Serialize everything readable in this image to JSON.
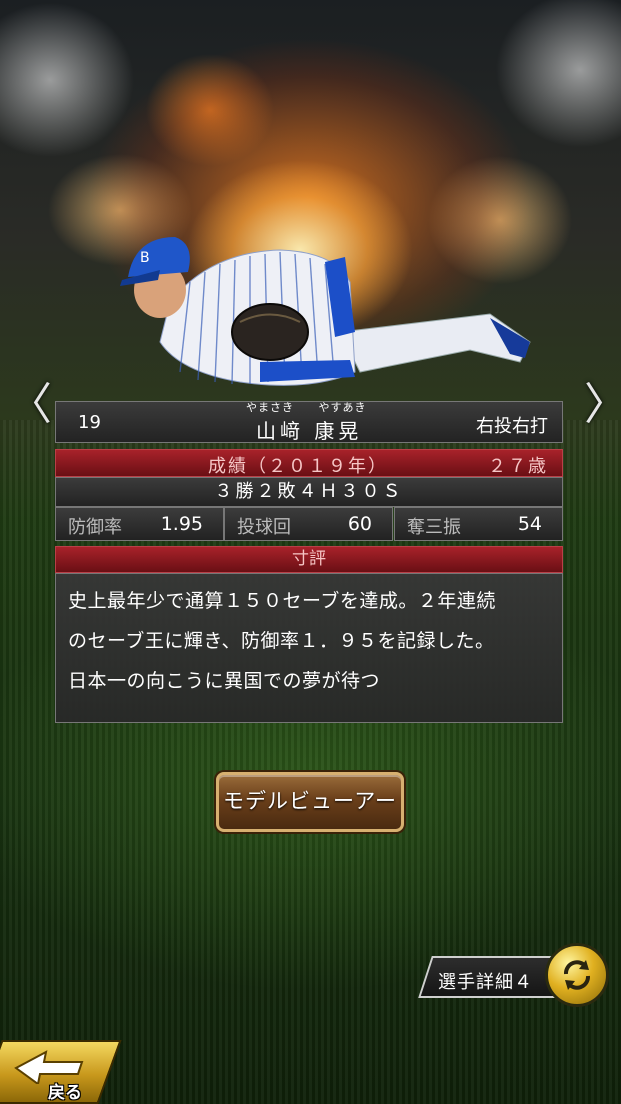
{
  "navigation": {
    "prev_icon": "chevron-left-icon",
    "next_icon": "chevron-right-icon",
    "prev_glyph": "〈",
    "next_glyph": "〉"
  },
  "player": {
    "number": "19",
    "ruby": [
      "やまさき",
      "やすあき"
    ],
    "name": "山﨑 康晃",
    "throws_bats": "右投右打"
  },
  "record": {
    "title": "成績（２０１９年）",
    "age": "２７歳",
    "summary": "３勝２敗４Ｈ３０Ｓ",
    "stats": [
      {
        "label": "防御率",
        "value": "1.95"
      },
      {
        "label": "投球回",
        "value": "60"
      },
      {
        "label": "奪三振",
        "value": "54"
      }
    ]
  },
  "review": {
    "title": "寸評",
    "lines": [
      "史上最年少で通算１５０セーブを達成。２年連続",
      "のセーブ王に輝き、防御率１．９５を記録した。",
      "日本一の向こうに異国での夢が待つ"
    ]
  },
  "buttons": {
    "model_viewer": "モデルビューアー",
    "player_detail": "選手詳細４",
    "back": "戻る"
  },
  "colors": {
    "header_red": "#a8222a",
    "button_gold": "#d7b070",
    "fire_orange": "#ff8a1e"
  }
}
